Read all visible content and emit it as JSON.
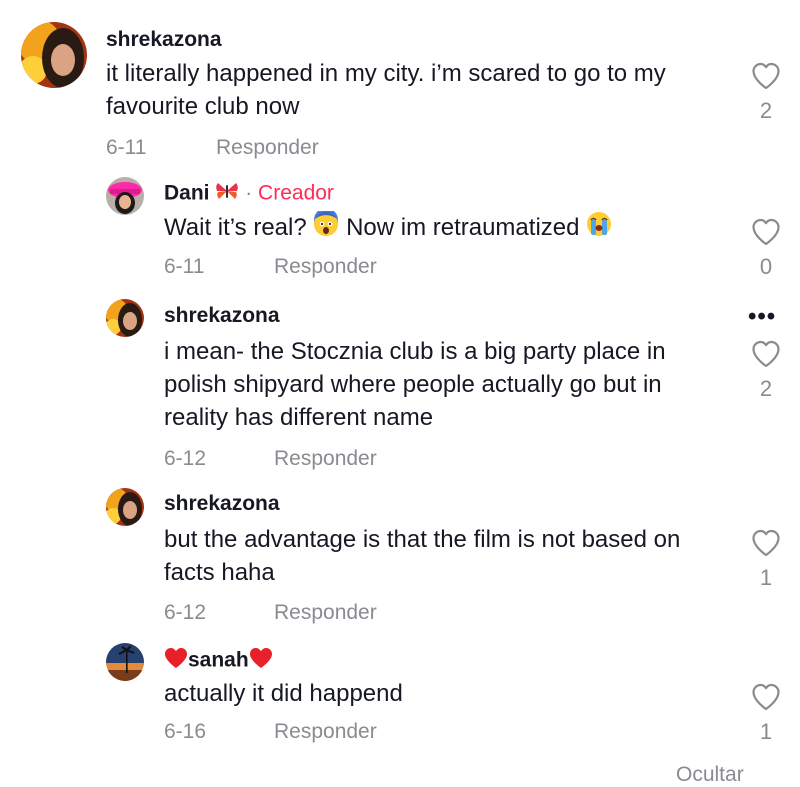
{
  "comments": [
    {
      "username": "shrekazona",
      "text": "it literally happened in my city. i’m scared to go to my favourite club now",
      "date": "6-11",
      "reply_label": "Responder",
      "likes": "2",
      "avatar": "woman-portrait-red-background"
    },
    {
      "username": "Dani",
      "username_emoji": "butterfly-emoji",
      "creator_separator": "·",
      "creator_label": "Creador",
      "text": "Wait it’s real?",
      "text_emoji_1": "fearful-face-emoji",
      "text_2": "Now im retraumatized",
      "text_emoji_2": "crying-face-emoji",
      "date": "6-11",
      "reply_label": "Responder",
      "likes": "0",
      "avatar": "person-pink-hat"
    },
    {
      "username": "shrekazona",
      "text": "i mean- the Stocznia club is a big party place in polish shipyard where people actually go but in reality has different name",
      "date": "6-12",
      "reply_label": "Responder",
      "likes": "2",
      "more_label": "•••",
      "avatar": "woman-portrait-red-background"
    },
    {
      "username": "shrekazona",
      "text": "but the advantage is that the film is not based on facts haha",
      "date": "6-12",
      "reply_label": "Responder",
      "likes": "1",
      "avatar": "woman-portrait-red-background"
    },
    {
      "username": "sanah",
      "username_prefix_emoji": "red-heart-emoji",
      "username_suffix_emoji": "red-heart-emoji",
      "text": "actually it did happend",
      "date": "6-16",
      "reply_label": "Responder",
      "likes": "1",
      "avatar": "palm-tree-sunset"
    }
  ],
  "footer": {
    "hide_label": "Ocultar"
  },
  "colors": {
    "creator": "#fe2c55",
    "muted": "#8a8b91",
    "text": "#161823"
  }
}
